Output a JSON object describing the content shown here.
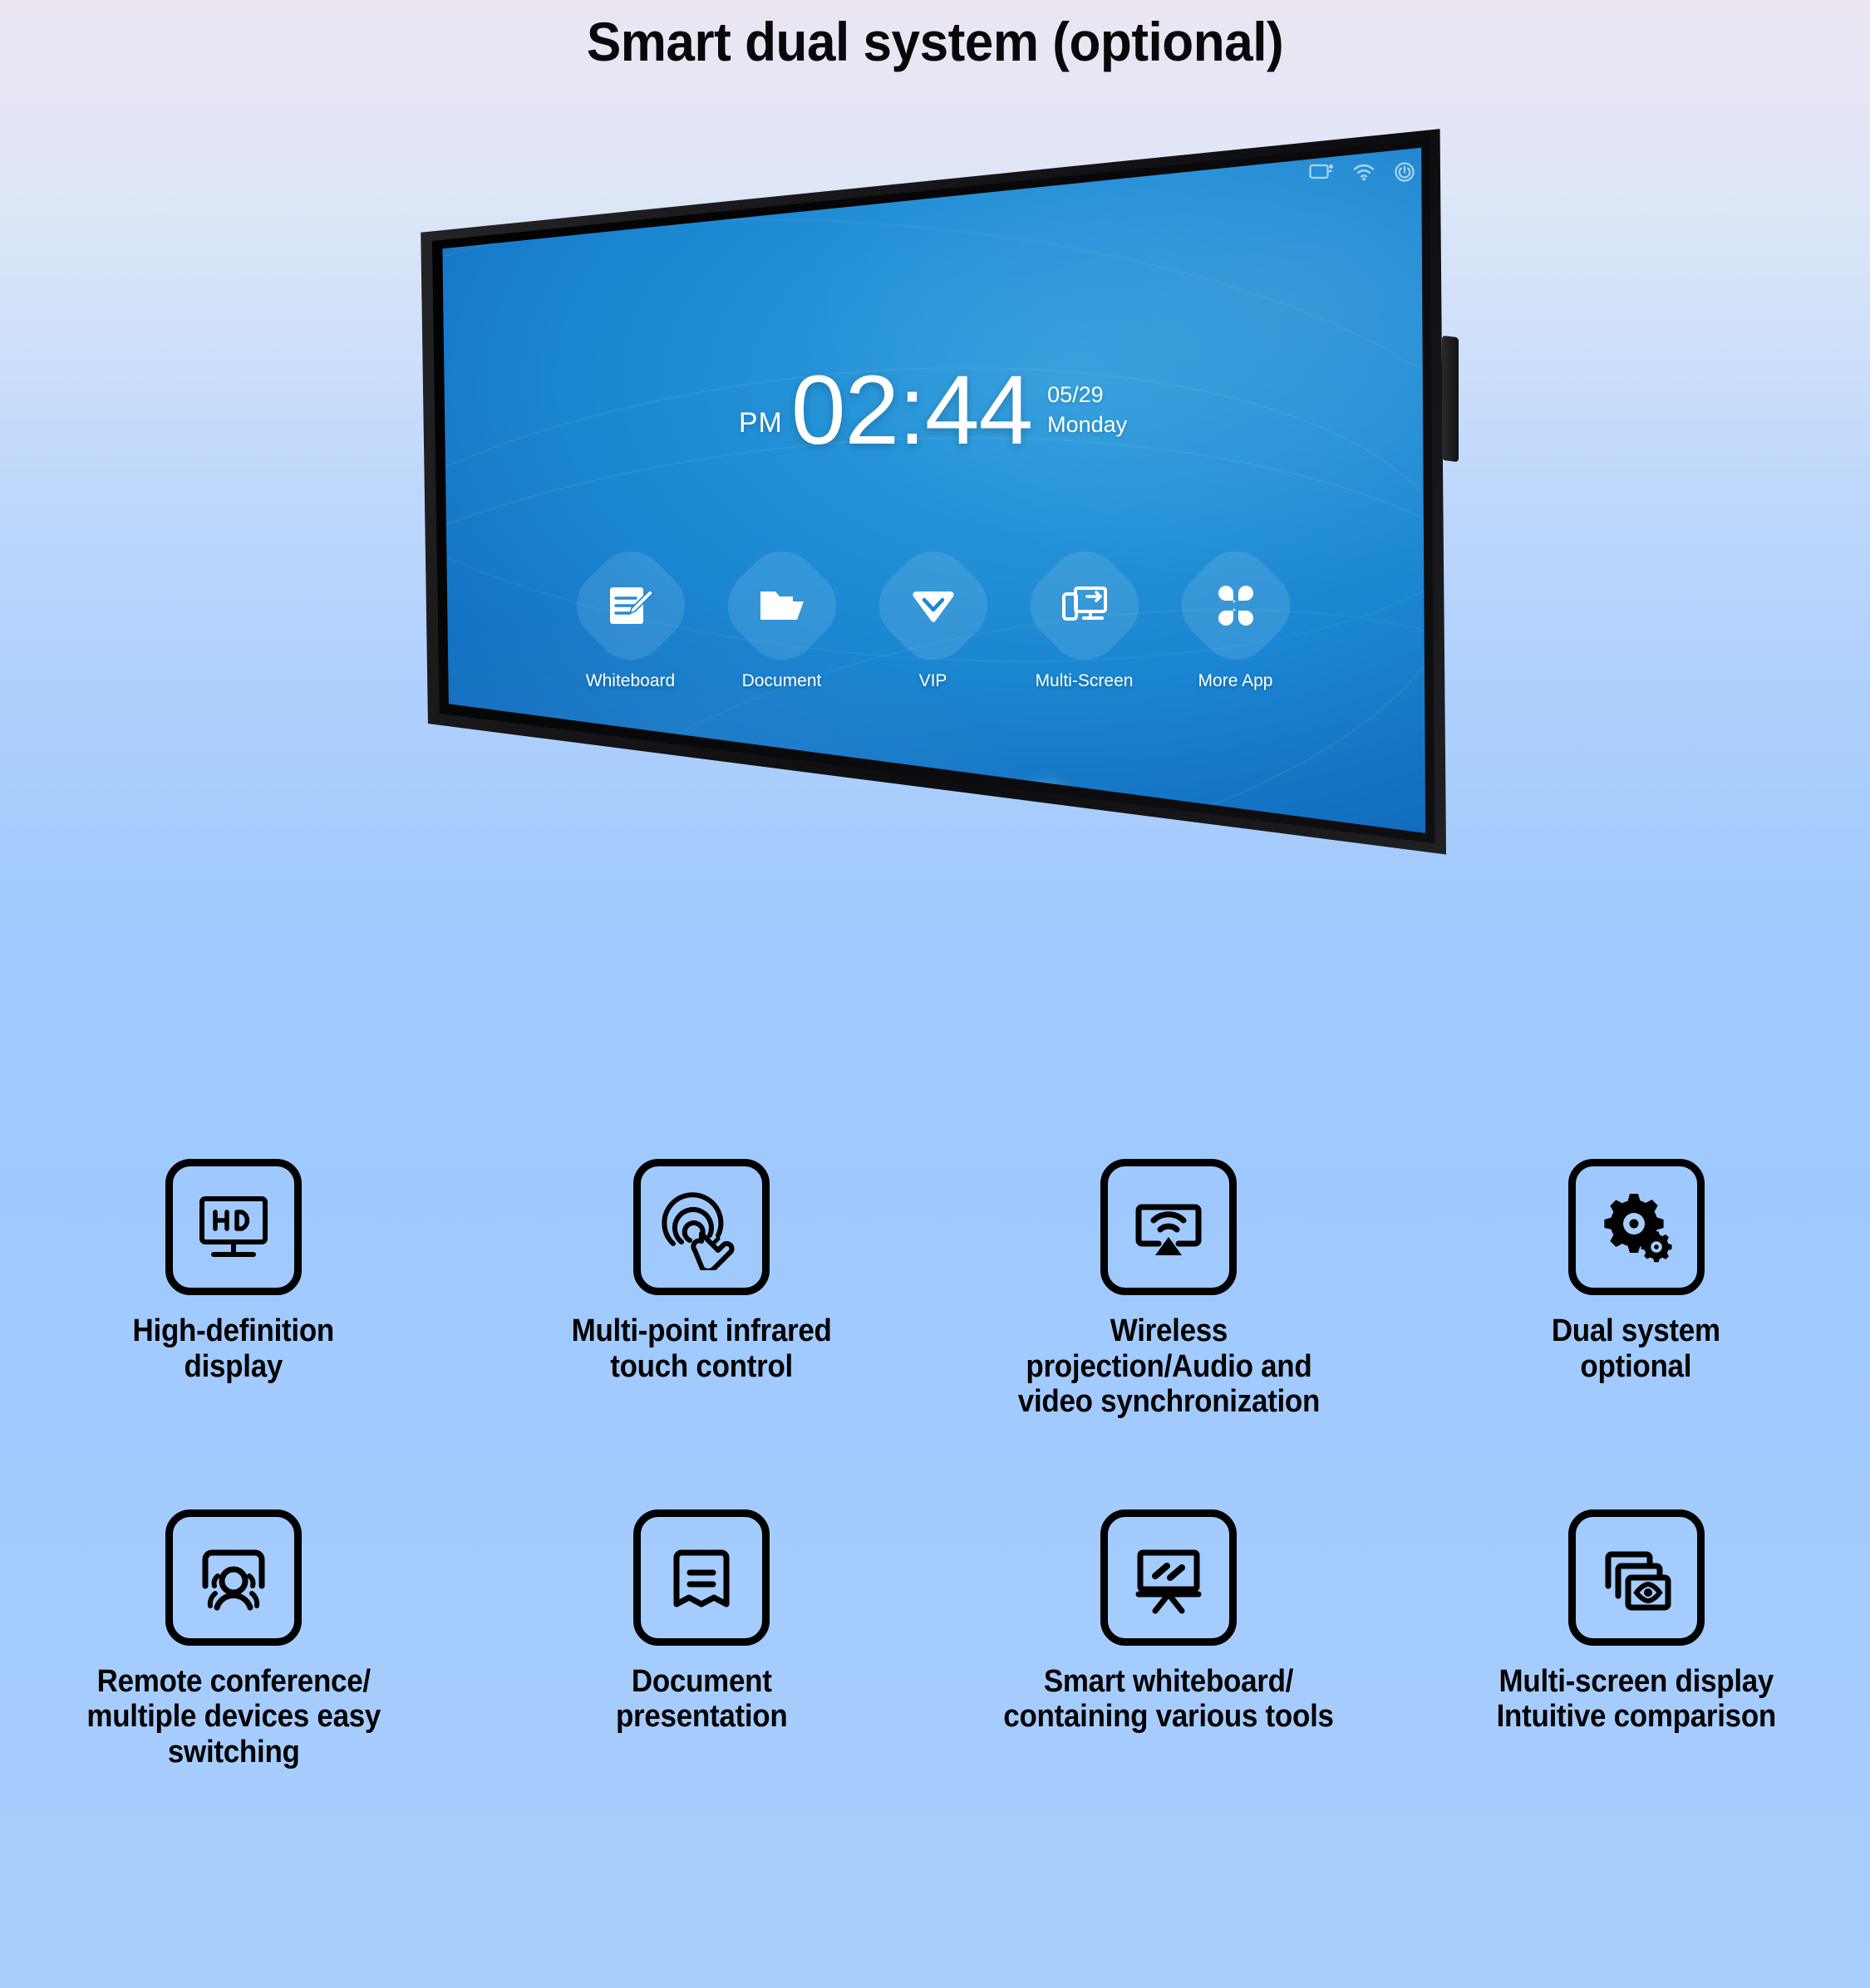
{
  "page": {
    "title": "Smart dual system (optional)",
    "background_top_color": "#ece5f2",
    "background_bottom_color": "#a8ceff"
  },
  "device": {
    "screen": {
      "statusbar": [
        {
          "icon": "screen-cast-icon",
          "name": "cast"
        },
        {
          "icon": "wifi-icon",
          "name": "wifi"
        },
        {
          "icon": "power-icon",
          "name": "power"
        }
      ],
      "clock": {
        "meridiem": "PM",
        "time": "02:44",
        "date": "05/29",
        "weekday": "Monday"
      },
      "apps": [
        {
          "label": "Whiteboard",
          "icon": "whiteboard-pen-icon"
        },
        {
          "label": "Document",
          "icon": "folder-icon"
        },
        {
          "label": "VIP",
          "icon": "diamond-icon"
        },
        {
          "label": "Multi-Screen",
          "icon": "multi-screen-icon"
        },
        {
          "label": "More App",
          "icon": "apps-grid-icon"
        }
      ],
      "home_button": "home-button"
    }
  },
  "features": {
    "row1": [
      {
        "icon": "hd-monitor-icon",
        "label": "High-definition\ndisplay"
      },
      {
        "icon": "touch-gesture-icon",
        "label": "Multi-point infrared\ntouch control"
      },
      {
        "icon": "wireless-cast-icon",
        "label": "Wireless\nprojection/Audio and\nvideo synchronization"
      },
      {
        "icon": "dual-gears-icon",
        "label": "Dual system\noptional"
      }
    ],
    "row2": [
      {
        "icon": "remote-conference-icon",
        "label": "Remote conference/\nmultiple devices easy\nswitching"
      },
      {
        "icon": "document-page-icon",
        "label": "Document\npresentation"
      },
      {
        "icon": "whiteboard-easel-icon",
        "label": "Smart whiteboard/\ncontaining various tools"
      },
      {
        "icon": "multi-window-eye-icon",
        "label": "Multi-screen display\nIntuitive comparison"
      }
    ]
  }
}
